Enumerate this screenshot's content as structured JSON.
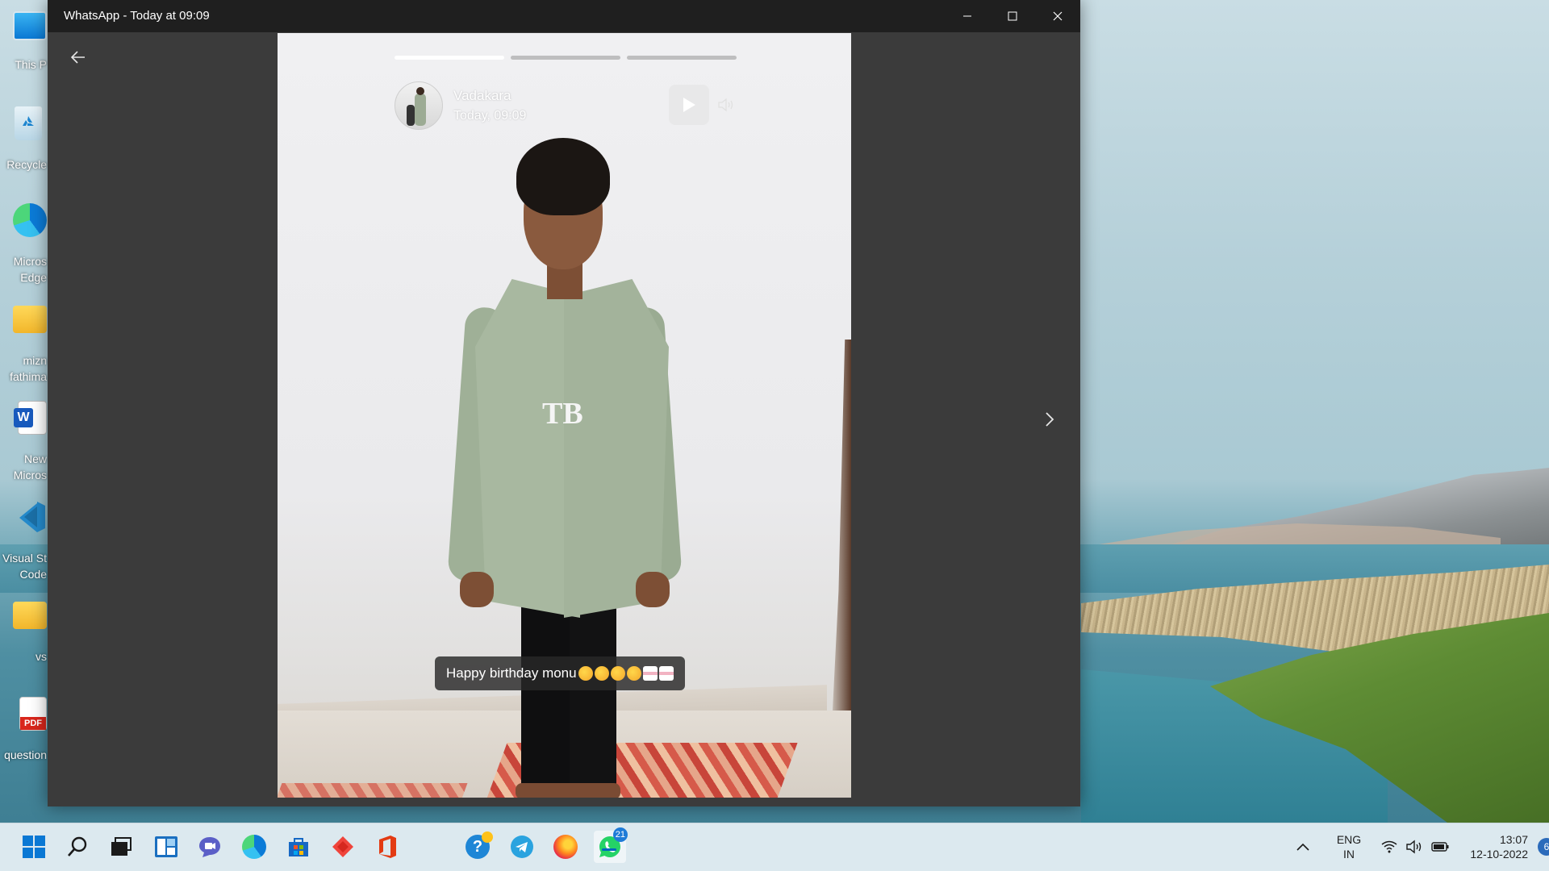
{
  "window": {
    "title": "WhatsApp - Today at 09:09"
  },
  "status": {
    "contact_name": "Vadakara",
    "timestamp": "Today, 09:09",
    "caption": "Happy birthday monu",
    "caption_emojis": [
      "birthday-face",
      "birthday-face",
      "star-struck",
      "star-struck",
      "cake",
      "cake"
    ],
    "segments": [
      {
        "progress": 1.0
      },
      {
        "progress": 0.0
      },
      {
        "progress": 0.0
      }
    ],
    "shirt_logo": "TB"
  },
  "desktop": {
    "icons": [
      {
        "label": "This P",
        "icon": "this-pc-icon"
      },
      {
        "label": "Recycle",
        "icon": "recycle-bin-icon"
      },
      {
        "label": "Micros",
        "label2": "Edge",
        "icon": "edge-shortcut-icon"
      },
      {
        "label": "mizn",
        "label2": "fathima",
        "icon": "folder-icon"
      },
      {
        "label": "New",
        "label2": "Micros",
        "icon": "word-doc-icon"
      },
      {
        "label": "Visual St",
        "label2": "Code",
        "icon": "vscode-shortcut-icon"
      },
      {
        "label": "vs",
        "icon": "folder-icon"
      },
      {
        "label": "question",
        "icon": "pdf-icon"
      }
    ]
  },
  "taskbar": {
    "apps": [
      {
        "name": "start-icon"
      },
      {
        "name": "search-icon"
      },
      {
        "name": "task-view-icon"
      },
      {
        "name": "widgets-icon"
      },
      {
        "name": "teams-chat-icon"
      },
      {
        "name": "edge-icon"
      },
      {
        "name": "microsoft-store-icon"
      },
      {
        "name": "anydesk-icon"
      },
      {
        "name": "office-icon"
      },
      {
        "name": "get-help-icon"
      },
      {
        "name": "telegram-icon"
      },
      {
        "name": "firefox-icon"
      },
      {
        "name": "whatsapp-icon"
      }
    ],
    "whatsapp_badge": "21",
    "language_line1": "ENG",
    "language_line2": "IN",
    "time": "13:07",
    "date": "12-10-2022",
    "notification_count": "6"
  },
  "colors": {
    "titlebar": "#1f1f1f",
    "window_bg": "#3b3b3b",
    "taskbar": "#dce9ef",
    "accent": "#0067c0",
    "whatsapp_green": "#25d366"
  }
}
